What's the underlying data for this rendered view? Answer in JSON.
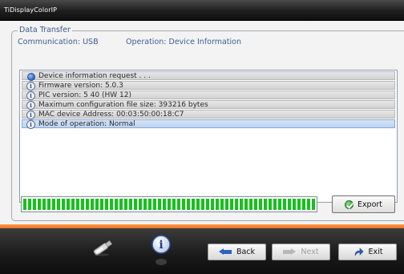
{
  "window": {
    "title": "TiDisplayColorIP"
  },
  "group": {
    "title": "Data Transfer"
  },
  "status": {
    "communication": "Communication: USB",
    "operation": "Operation: Device Information"
  },
  "log": {
    "rows": [
      {
        "icon": "status-dot-icon",
        "text": "Device information request . . ."
      },
      {
        "icon": "info-icon",
        "text": "Firmware version: 5.0.3"
      },
      {
        "icon": "info-icon",
        "text": "PIC version: 5 40 (HW 12)"
      },
      {
        "icon": "info-icon",
        "text": "Maximum configuration file size: 393216 bytes"
      },
      {
        "icon": "info-icon",
        "text": "MAC device Address: 00:03:50:00:18:C7"
      },
      {
        "icon": "info-icon",
        "text": "Mode of operation: Normal"
      }
    ],
    "selected_index": 5
  },
  "progress": {
    "percent": 100,
    "color": "#15c21b"
  },
  "buttons": {
    "export": "Export",
    "back": "Back",
    "next": "Next",
    "exit": "Exit"
  },
  "colors": {
    "accent": "#e8731e",
    "label_blue": "#3a5f96",
    "title_bar": "#1e1e1e"
  }
}
